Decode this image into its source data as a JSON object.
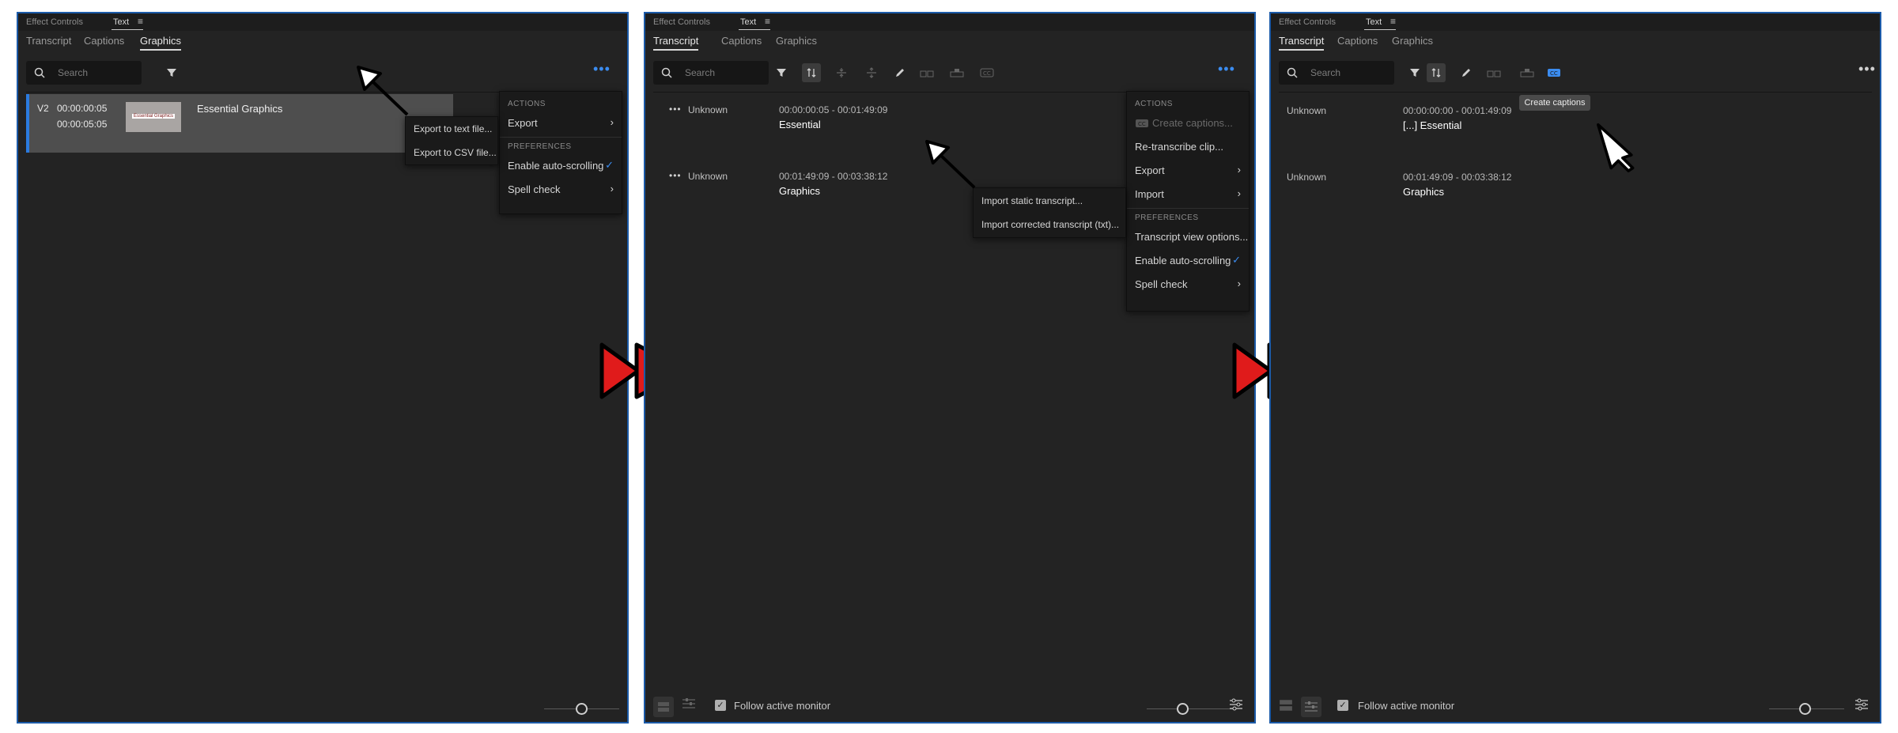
{
  "panels": [
    {
      "header": {
        "tab1": "Effect Controls",
        "tab2": "Text"
      },
      "subtabs": [
        "Transcript",
        "Captions",
        "Graphics"
      ],
      "active_subtab": "Graphics",
      "search_placeholder": "Search",
      "clip": {
        "track": "V2",
        "tc_in": "00:00:00:05",
        "tc_out": "00:00:05:05",
        "thumb_text": "Essential Graphics",
        "name": "Essential Graphics"
      },
      "menu": {
        "actions_header": "ACTIONS",
        "items": [
          "Export"
        ],
        "prefs_header": "PREFERENCES",
        "pref_items": [
          "Enable auto-scrolling",
          "Spell check"
        ]
      },
      "submenu": [
        "Export to text file...",
        "Export to CSV file..."
      ]
    },
    {
      "header": {
        "tab1": "Effect Controls",
        "tab2": "Text"
      },
      "subtabs": [
        "Transcript",
        "Captions",
        "Graphics"
      ],
      "active_subtab": "Transcript",
      "search_placeholder": "Search",
      "rows": [
        {
          "speaker": "Unknown",
          "timecode": "00:00:00:05 - 00:01:49:09",
          "text": "Essential"
        },
        {
          "speaker": "Unknown",
          "timecode": "00:01:49:09 - 00:03:38:12",
          "text": "Graphics"
        }
      ],
      "menu": {
        "actions_header": "ACTIONS",
        "items": [
          "Create captions...",
          "Re-transcribe clip...",
          "Export",
          "Import"
        ],
        "prefs_header": "PREFERENCES",
        "pref_items": [
          "Transcript view options...",
          "Enable auto-scrolling",
          "Spell check"
        ]
      },
      "submenu": [
        "Import static transcript...",
        "Import corrected transcript (txt)..."
      ],
      "footer_label": "Follow active monitor"
    },
    {
      "header": {
        "tab1": "Effect Controls",
        "tab2": "Text"
      },
      "subtabs": [
        "Transcript",
        "Captions",
        "Graphics"
      ],
      "active_subtab": "Transcript",
      "search_placeholder": "Search",
      "rows": [
        {
          "speaker": "Unknown",
          "timecode": "00:00:00:00 - 00:01:49:09",
          "text": "[...] Essential"
        },
        {
          "speaker": "Unknown",
          "timecode": "00:01:49:09 - 00:03:38:12",
          "text": "Graphics"
        }
      ],
      "tooltip": "Create captions",
      "footer_label": "Follow active monitor"
    }
  ],
  "colors": {
    "panel_bg": "#232323",
    "accent_blue": "#3b8cf0",
    "panel_border": "#1b5aa8",
    "arrow_red": "#e01b1b"
  }
}
